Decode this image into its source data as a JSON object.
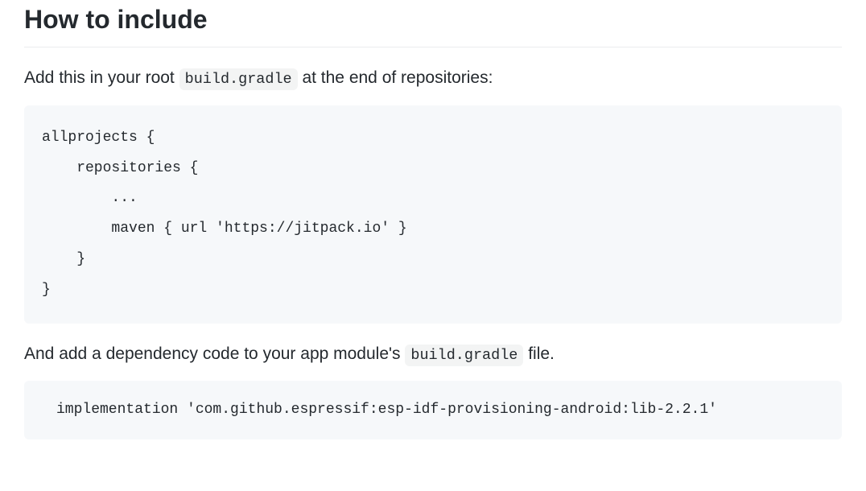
{
  "heading": "How to include",
  "paragraph1": {
    "prefix": "Add this in your root ",
    "code": "build.gradle",
    "suffix": " at the end of repositories:"
  },
  "codeblock1": "allprojects {\n    repositories {\n        ...\n        maven { url 'https://jitpack.io' }\n    }\n}",
  "paragraph2": {
    "prefix": "And add a dependency code to your app module's ",
    "code": "build.gradle",
    "suffix": " file."
  },
  "codeblock2": "implementation 'com.github.espressif:esp-idf-provisioning-android:lib-2.2.1'"
}
